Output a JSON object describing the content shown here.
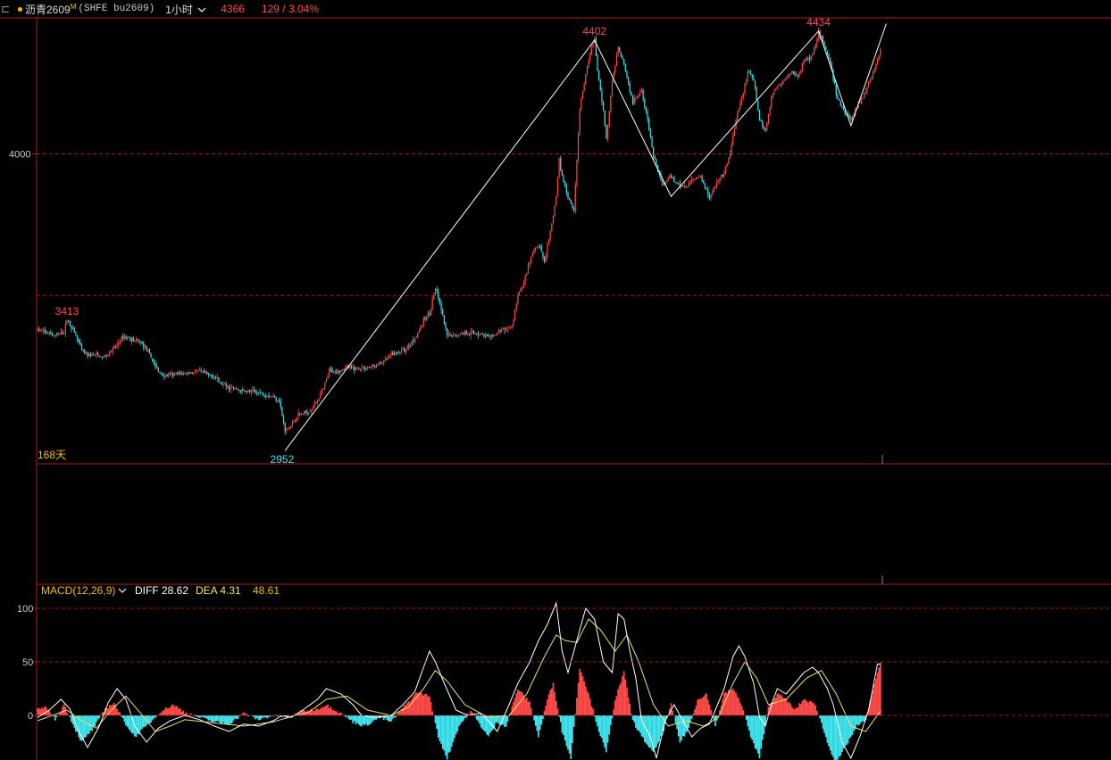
{
  "header": {
    "menu_icon": "⊏",
    "dot_color": "#f0c000",
    "symbol_name": "沥青2609",
    "symbol_suffix": "M",
    "exchange_code": "(SHFE bu2609)",
    "timeframe": "1小时",
    "last_price": "4366",
    "change": "129 / 3.04%"
  },
  "colors": {
    "up": "#ff4a4a",
    "down": "#3fe4ee",
    "grid": "#a01818",
    "border": "#b01a1a",
    "zigzag": "#ffffff",
    "diff_line": "#ffffff",
    "dea_line": "#f0e070"
  },
  "main_panel": {
    "range_label": "168天",
    "price_axis": {
      "ticks": [
        4000
      ],
      "ylim": [
        2918,
        4468
      ]
    }
  },
  "macd": {
    "title": "MACD(12,26,9)",
    "diff_label": "DIFF 28.62",
    "dea_label": "DEA 4.31",
    "macd_value": "48.61",
    "axis_ticks": [
      "100",
      "50",
      "0"
    ]
  },
  "chart_data": [
    {
      "type": "candlestick",
      "title": "沥青2609 1小时",
      "ylim": [
        2918,
        4468
      ],
      "y_gridlines": [
        4000,
        3500
      ],
      "close_path": [
        [
          0,
          3380
        ],
        [
          8,
          3365
        ],
        [
          12,
          3358
        ],
        [
          18,
          3370
        ],
        [
          20,
          3415
        ],
        [
          23,
          3390
        ],
        [
          26,
          3360
        ],
        [
          30,
          3305
        ],
        [
          34,
          3290
        ],
        [
          40,
          3290
        ],
        [
          44,
          3280
        ],
        [
          48,
          3292
        ],
        [
          54,
          3325
        ],
        [
          58,
          3355
        ],
        [
          62,
          3350
        ],
        [
          66,
          3340
        ],
        [
          70,
          3335
        ],
        [
          74,
          3310
        ],
        [
          78,
          3270
        ],
        [
          82,
          3230
        ],
        [
          86,
          3215
        ],
        [
          92,
          3220
        ],
        [
          100,
          3225
        ],
        [
          110,
          3232
        ],
        [
          116,
          3218
        ],
        [
          120,
          3215
        ],
        [
          124,
          3190
        ],
        [
          130,
          3175
        ],
        [
          140,
          3162
        ],
        [
          150,
          3158
        ],
        [
          160,
          3142
        ],
        [
          164,
          3130
        ],
        [
          168,
          3020
        ],
        [
          172,
          3040
        ],
        [
          176,
          3075
        ],
        [
          184,
          3090
        ],
        [
          190,
          3130
        ],
        [
          194,
          3170
        ],
        [
          198,
          3235
        ],
        [
          202,
          3232
        ],
        [
          210,
          3245
        ],
        [
          220,
          3242
        ],
        [
          230,
          3252
        ],
        [
          236,
          3270
        ],
        [
          240,
          3290
        ],
        [
          250,
          3310
        ],
        [
          256,
          3350
        ],
        [
          262,
          3410
        ],
        [
          266,
          3440
        ],
        [
          270,
          3525
        ],
        [
          274,
          3450
        ],
        [
          278,
          3355
        ],
        [
          284,
          3360
        ],
        [
          290,
          3370
        ],
        [
          300,
          3365
        ],
        [
          308,
          3350
        ],
        [
          312,
          3370
        ],
        [
          316,
          3380
        ],
        [
          322,
          3390
        ],
        [
          326,
          3500
        ],
        [
          330,
          3545
        ],
        [
          336,
          3650
        ],
        [
          340,
          3680
        ],
        [
          344,
          3620
        ],
        [
          348,
          3720
        ],
        [
          352,
          3850
        ],
        [
          354,
          3980
        ],
        [
          356,
          3920
        ],
        [
          360,
          3850
        ],
        [
          364,
          3800
        ],
        [
          368,
          4160
        ],
        [
          372,
          4280
        ],
        [
          376,
          4380
        ],
        [
          378,
          4402
        ],
        [
          380,
          4300
        ],
        [
          384,
          4150
        ],
        [
          386,
          4050
        ],
        [
          390,
          4250
        ],
        [
          394,
          4380
        ],
        [
          398,
          4320
        ],
        [
          400,
          4270
        ],
        [
          404,
          4180
        ],
        [
          410,
          4230
        ],
        [
          414,
          4120
        ],
        [
          418,
          3990
        ],
        [
          424,
          3890
        ],
        [
          430,
          3920
        ],
        [
          434,
          3895
        ],
        [
          440,
          3880
        ],
        [
          444,
          3910
        ],
        [
          450,
          3920
        ],
        [
          456,
          3850
        ],
        [
          460,
          3890
        ],
        [
          466,
          3930
        ],
        [
          470,
          4000
        ],
        [
          474,
          4120
        ],
        [
          478,
          4200
        ],
        [
          482,
          4290
        ],
        [
          486,
          4260
        ],
        [
          490,
          4120
        ],
        [
          494,
          4080
        ],
        [
          498,
          4200
        ],
        [
          502,
          4240
        ],
        [
          506,
          4260
        ],
        [
          512,
          4290
        ],
        [
          516,
          4270
        ],
        [
          520,
          4330
        ],
        [
          526,
          4350
        ],
        [
          530,
          4434
        ],
        [
          534,
          4380
        ],
        [
          538,
          4320
        ],
        [
          542,
          4210
        ],
        [
          546,
          4160
        ],
        [
          552,
          4120
        ],
        [
          556,
          4170
        ],
        [
          560,
          4200
        ],
        [
          564,
          4250
        ],
        [
          568,
          4300
        ],
        [
          572,
          4366
        ]
      ],
      "annotations": [
        {
          "label": "3413",
          "index": 20,
          "value": 3413,
          "kind": "high"
        },
        {
          "label": "2952",
          "index": 166,
          "value": 2952,
          "kind": "low"
        },
        {
          "label": "4402",
          "index": 378,
          "value": 4402,
          "kind": "high"
        },
        {
          "label": "4434",
          "index": 530,
          "value": 4434,
          "kind": "high"
        }
      ],
      "zigzag": [
        [
          168,
          2952
        ],
        [
          378,
          4402
        ],
        [
          430,
          3850
        ],
        [
          530,
          4434
        ],
        [
          552,
          4100
        ],
        [
          576,
          4460
        ]
      ]
    },
    {
      "type": "macd",
      "title": "MACD(12,26,9)",
      "ylim": [
        -40,
        110
      ],
      "y_gridlines": [
        100,
        50,
        0
      ],
      "diff_path": [
        [
          0,
          -2
        ],
        [
          8,
          5
        ],
        [
          16,
          15
        ],
        [
          22,
          6
        ],
        [
          28,
          -15
        ],
        [
          34,
          -30
        ],
        [
          42,
          -10
        ],
        [
          48,
          12
        ],
        [
          54,
          25
        ],
        [
          60,
          15
        ],
        [
          66,
          -10
        ],
        [
          74,
          -25
        ],
        [
          82,
          -12
        ],
        [
          90,
          -5
        ],
        [
          100,
          0
        ],
        [
          110,
          -4
        ],
        [
          120,
          -10
        ],
        [
          130,
          -15
        ],
        [
          140,
          -8
        ],
        [
          150,
          -10
        ],
        [
          160,
          -5
        ],
        [
          166,
          0
        ],
        [
          172,
          -2
        ],
        [
          180,
          5
        ],
        [
          190,
          15
        ],
        [
          196,
          25
        ],
        [
          206,
          20
        ],
        [
          214,
          10
        ],
        [
          220,
          0
        ],
        [
          230,
          -2
        ],
        [
          240,
          0
        ],
        [
          248,
          10
        ],
        [
          256,
          22
        ],
        [
          262,
          45
        ],
        [
          266,
          60
        ],
        [
          270,
          50
        ],
        [
          276,
          30
        ],
        [
          284,
          5
        ],
        [
          292,
          0
        ],
        [
          300,
          2
        ],
        [
          306,
          -5
        ],
        [
          312,
          -15
        ],
        [
          320,
          10
        ],
        [
          326,
          30
        ],
        [
          334,
          50
        ],
        [
          340,
          70
        ],
        [
          346,
          85
        ],
        [
          352,
          105
        ],
        [
          356,
          60
        ],
        [
          360,
          40
        ],
        [
          366,
          70
        ],
        [
          372,
          100
        ],
        [
          378,
          90
        ],
        [
          384,
          50
        ],
        [
          390,
          40
        ],
        [
          394,
          95
        ],
        [
          398,
          90
        ],
        [
          402,
          60
        ],
        [
          406,
          35
        ],
        [
          410,
          -5
        ],
        [
          416,
          -20
        ],
        [
          420,
          -40
        ],
        [
          426,
          -5
        ],
        [
          432,
          10
        ],
        [
          438,
          -5
        ],
        [
          444,
          -20
        ],
        [
          450,
          -12
        ],
        [
          456,
          -8
        ],
        [
          460,
          5
        ],
        [
          466,
          25
        ],
        [
          472,
          55
        ],
        [
          476,
          65
        ],
        [
          480,
          55
        ],
        [
          486,
          30
        ],
        [
          490,
          -2
        ],
        [
          494,
          -10
        ],
        [
          498,
          10
        ],
        [
          502,
          25
        ],
        [
          508,
          20
        ],
        [
          514,
          30
        ],
        [
          520,
          40
        ],
        [
          526,
          45
        ],
        [
          530,
          40
        ],
        [
          536,
          25
        ],
        [
          540,
          10
        ],
        [
          546,
          -25
        ],
        [
          552,
          -40
        ],
        [
          558,
          -20
        ],
        [
          564,
          5
        ],
        [
          570,
          48
        ]
      ],
      "dea_path": [
        [
          0,
          -5
        ],
        [
          10,
          0
        ],
        [
          20,
          5
        ],
        [
          30,
          -5
        ],
        [
          40,
          -12
        ],
        [
          50,
          5
        ],
        [
          60,
          18
        ],
        [
          70,
          2
        ],
        [
          80,
          -15
        ],
        [
          90,
          -10
        ],
        [
          100,
          -4
        ],
        [
          120,
          -7
        ],
        [
          140,
          -10
        ],
        [
          160,
          -6
        ],
        [
          170,
          -2
        ],
        [
          184,
          3
        ],
        [
          196,
          15
        ],
        [
          210,
          18
        ],
        [
          224,
          5
        ],
        [
          240,
          0
        ],
        [
          252,
          8
        ],
        [
          262,
          25
        ],
        [
          270,
          42
        ],
        [
          278,
          32
        ],
        [
          290,
          10
        ],
        [
          306,
          -2
        ],
        [
          320,
          0
        ],
        [
          332,
          20
        ],
        [
          344,
          55
        ],
        [
          352,
          75
        ],
        [
          358,
          70
        ],
        [
          366,
          68
        ],
        [
          374,
          90
        ],
        [
          382,
          80
        ],
        [
          392,
          60
        ],
        [
          400,
          75
        ],
        [
          408,
          50
        ],
        [
          418,
          10
        ],
        [
          428,
          -10
        ],
        [
          440,
          -5
        ],
        [
          452,
          -10
        ],
        [
          462,
          -2
        ],
        [
          472,
          30
        ],
        [
          480,
          50
        ],
        [
          488,
          35
        ],
        [
          496,
          10
        ],
        [
          508,
          15
        ],
        [
          522,
          35
        ],
        [
          532,
          42
        ],
        [
          542,
          20
        ],
        [
          552,
          -10
        ],
        [
          562,
          -15
        ],
        [
          572,
          4
        ]
      ],
      "hist_path": [
        [
          0,
          5
        ],
        [
          6,
          8
        ],
        [
          12,
          -4
        ],
        [
          18,
          10
        ],
        [
          24,
          -8
        ],
        [
          30,
          -25
        ],
        [
          38,
          -12
        ],
        [
          46,
          6
        ],
        [
          52,
          12
        ],
        [
          58,
          -4
        ],
        [
          66,
          -20
        ],
        [
          74,
          -10
        ],
        [
          84,
          4
        ],
        [
          92,
          10
        ],
        [
          100,
          3
        ],
        [
          110,
          -2
        ],
        [
          120,
          -6
        ],
        [
          130,
          -8
        ],
        [
          140,
          2
        ],
        [
          150,
          -4
        ],
        [
          160,
          0
        ],
        [
          170,
          -2
        ],
        [
          180,
          4
        ],
        [
          190,
          6
        ],
        [
          196,
          10
        ],
        [
          206,
          2
        ],
        [
          214,
          -6
        ],
        [
          222,
          -10
        ],
        [
          232,
          -2
        ],
        [
          240,
          -6
        ],
        [
          250,
          10
        ],
        [
          258,
          22
        ],
        [
          266,
          18
        ],
        [
          272,
          -20
        ],
        [
          278,
          -40
        ],
        [
          286,
          -10
        ],
        [
          294,
          4
        ],
        [
          300,
          -8
        ],
        [
          306,
          -20
        ],
        [
          312,
          -6
        ],
        [
          318,
          -10
        ],
        [
          326,
          25
        ],
        [
          334,
          12
        ],
        [
          340,
          -20
        ],
        [
          346,
          15
        ],
        [
          350,
          30
        ],
        [
          356,
          -15
        ],
        [
          362,
          -40
        ],
        [
          368,
          45
        ],
        [
          374,
          20
        ],
        [
          380,
          -10
        ],
        [
          386,
          -35
        ],
        [
          392,
          15
        ],
        [
          398,
          40
        ],
        [
          404,
          -5
        ],
        [
          410,
          -20
        ],
        [
          418,
          -35
        ],
        [
          424,
          -18
        ],
        [
          430,
          10
        ],
        [
          436,
          -25
        ],
        [
          442,
          -12
        ],
        [
          448,
          15
        ],
        [
          454,
          20
        ],
        [
          460,
          -10
        ],
        [
          466,
          20
        ],
        [
          472,
          25
        ],
        [
          478,
          10
        ],
        [
          484,
          -20
        ],
        [
          490,
          -40
        ],
        [
          496,
          8
        ],
        [
          502,
          20
        ],
        [
          508,
          15
        ],
        [
          514,
          5
        ],
        [
          520,
          15
        ],
        [
          528,
          10
        ],
        [
          536,
          -25
        ],
        [
          542,
          -45
        ],
        [
          548,
          -30
        ],
        [
          556,
          -10
        ],
        [
          562,
          -5
        ],
        [
          568,
          30
        ],
        [
          572,
          48
        ]
      ]
    }
  ]
}
